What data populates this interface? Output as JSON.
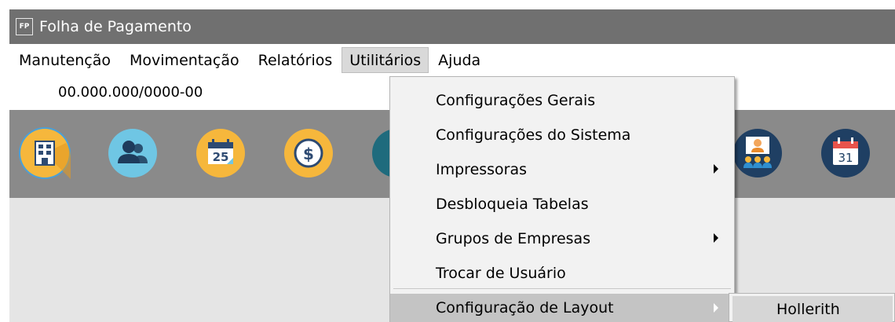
{
  "window": {
    "app_icon_label": "FP",
    "title": "Folha de Pagamento"
  },
  "menubar": {
    "items": [
      {
        "label": "Manutenção"
      },
      {
        "label": "Movimentação"
      },
      {
        "label": "Relatórios"
      },
      {
        "label": "Utilitários"
      },
      {
        "label": "Ajuda"
      }
    ],
    "active": "Utilitários"
  },
  "company": {
    "cnpj": "00.000.000/0000-00"
  },
  "toolbar": {
    "icons": [
      "building-icon",
      "users-icon",
      "calendar-25-icon",
      "dollar-coin-icon",
      "partial-icon",
      "presentation-team-icon",
      "calendar-31-icon"
    ],
    "calendar_day_1": "25",
    "calendar_day_2": "31"
  },
  "utilitarios_menu": {
    "items": [
      {
        "label": "Configurações Gerais"
      },
      {
        "label": "Configurações do Sistema"
      },
      {
        "label": "Impressoras"
      },
      {
        "label": "Desbloqueia Tabelas"
      },
      {
        "label": "Grupos de Empresas"
      },
      {
        "label": "Trocar de Usuário"
      },
      {
        "label": "Configuração de Layout"
      }
    ]
  },
  "layout_submenu": {
    "items": [
      {
        "label": "Hollerith"
      }
    ]
  },
  "colors": {
    "titlebar": "#707070",
    "toolbar": "#8a8a8a",
    "content": "#e5e5e5",
    "menu_bg": "#f2f2f2",
    "hover": "#c4c4c4"
  }
}
